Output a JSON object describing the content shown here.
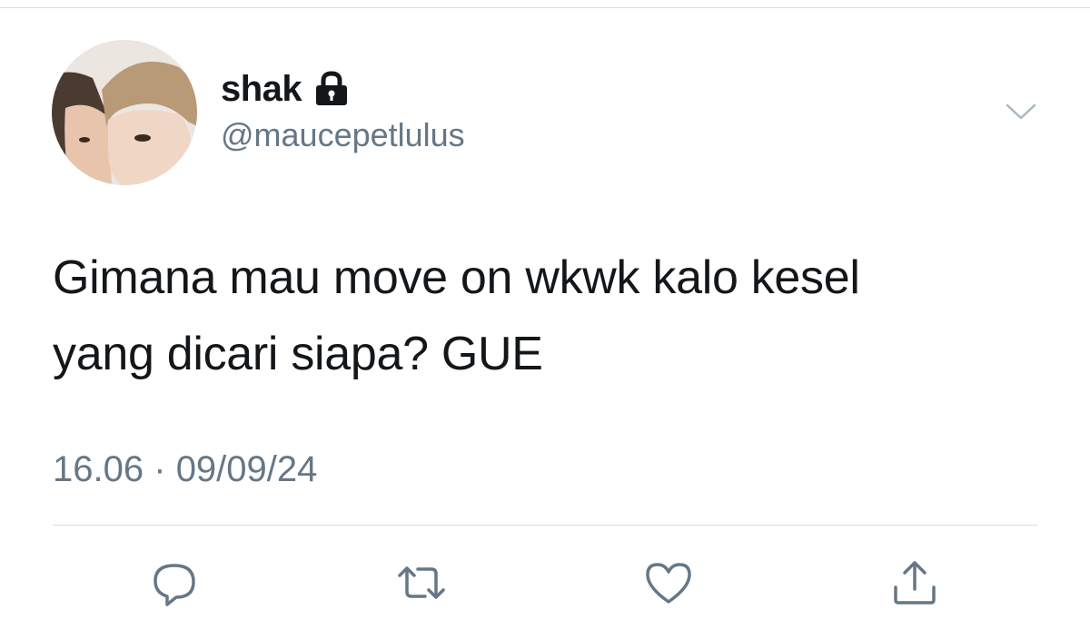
{
  "user": {
    "display_name": "shak",
    "handle": "@maucepetlulus",
    "protected_icon": "lock-icon",
    "avatar": "profile-photo"
  },
  "tweet": {
    "lines": [
      "Gimana mau move on wkwk kalo kesel",
      "yang dicari siapa? GUE"
    ],
    "time": "16.06",
    "separator": "·",
    "date": "09/09/24"
  },
  "header": {
    "menu_icon": "chevron-down-icon"
  },
  "actions": [
    {
      "name": "reply",
      "icon": "reply-icon"
    },
    {
      "name": "retweet",
      "icon": "retweet-icon"
    },
    {
      "name": "like",
      "icon": "heart-icon"
    },
    {
      "name": "share",
      "icon": "share-icon"
    }
  ],
  "colors": {
    "text": "#14171a",
    "secondary": "#657786",
    "divider": "#d6dbdf",
    "icon": "#657786"
  }
}
